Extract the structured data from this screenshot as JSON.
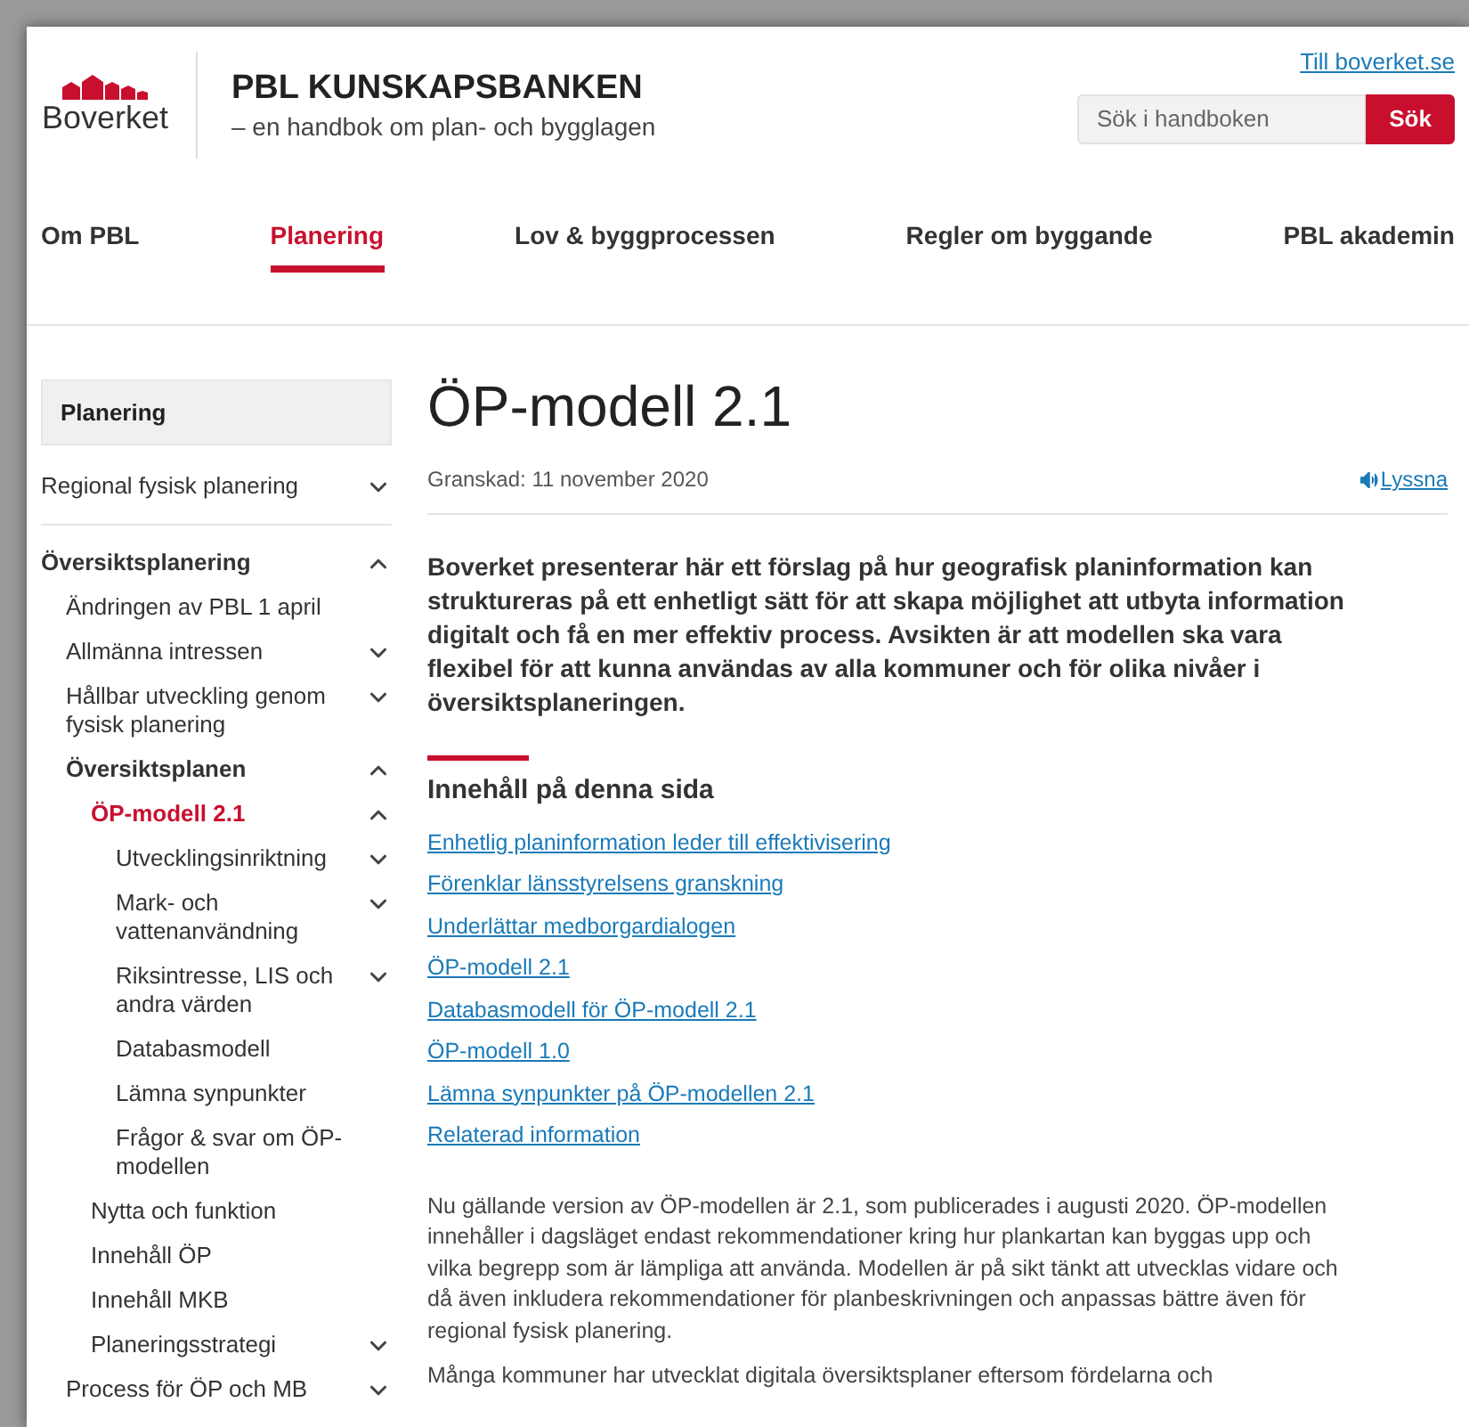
{
  "header": {
    "logo_text": "Boverket",
    "site_title": "PBL KUNSKAPSBANKEN",
    "site_subtitle": "– en handbok om plan- och bygglagen",
    "external_link": "Till boverket.se",
    "search": {
      "placeholder": "Sök i handboken",
      "button": "Sök"
    }
  },
  "nav": [
    {
      "label": "Om PBL",
      "selected": false
    },
    {
      "label": "Planering",
      "selected": true
    },
    {
      "label": "Lov & byggprocessen",
      "selected": false
    },
    {
      "label": "Regler om byggande",
      "selected": false
    },
    {
      "label": "PBL akademin",
      "selected": false
    }
  ],
  "sidebar": {
    "heading": "Planering",
    "items": [
      {
        "label": "Regional fysisk planering",
        "kind": "group",
        "expanded": false,
        "selected": false
      },
      {
        "label": "Översiktsplanering",
        "kind": "group",
        "expanded": true,
        "selected": false,
        "children": [
          {
            "label": "Ändringen av PBL 1 april",
            "kind": "leaf",
            "expanded": false,
            "selected": false
          },
          {
            "label": "Allmänna intressen",
            "kind": "group",
            "expanded": false,
            "selected": false
          },
          {
            "label": "Hållbar utveckling genom fysisk planering",
            "kind": "group",
            "expanded": false,
            "selected": false
          },
          {
            "label": "Översiktsplanen",
            "kind": "group",
            "expanded": true,
            "selected": false,
            "children": [
              {
                "label": "ÖP-modell 2.1",
                "kind": "group",
                "expanded": true,
                "selected": true,
                "children": [
                  {
                    "label": "Utvecklingsinriktning",
                    "kind": "group",
                    "expanded": false,
                    "selected": false
                  },
                  {
                    "label": "Mark- och vattenanvändning",
                    "kind": "group",
                    "expanded": false,
                    "selected": false
                  },
                  {
                    "label": "Riksintresse, LIS och andra värden",
                    "kind": "group",
                    "expanded": false,
                    "selected": false
                  },
                  {
                    "label": "Databasmodell",
                    "kind": "leaf",
                    "expanded": false,
                    "selected": false
                  },
                  {
                    "label": "Lämna synpunkter",
                    "kind": "leaf",
                    "expanded": false,
                    "selected": false
                  },
                  {
                    "label": "Frågor & svar om ÖP-modellen",
                    "kind": "leaf",
                    "expanded": false,
                    "selected": false
                  }
                ]
              },
              {
                "label": "Nytta och funktion",
                "kind": "leaf",
                "expanded": false,
                "selected": false
              },
              {
                "label": "Innehåll ÖP",
                "kind": "leaf",
                "expanded": false,
                "selected": false
              },
              {
                "label": "Innehåll MKB",
                "kind": "leaf",
                "expanded": false,
                "selected": false
              },
              {
                "label": "Planeringsstrategi",
                "kind": "group",
                "expanded": false,
                "selected": false
              }
            ]
          },
          {
            "label": "Process för ÖP och MB",
            "kind": "group",
            "expanded": false,
            "selected": false
          }
        ]
      }
    ]
  },
  "article": {
    "title": "ÖP-modell 2.1",
    "reviewed": "Granskad: 11 november 2020",
    "listen": "Lyssna",
    "lead": "Boverket presenterar här ett förslag på hur geografisk planinformation kan struktureras på ett enhetligt sätt för att skapa möjlighet att utbyta information digitalt och få en mer effektiv process. Avsikten är att modellen ska vara flexibel för att kunna användas av alla kommuner och för olika nivåer i översiktsplaneringen.",
    "toc_heading": "Innehåll på denna sida",
    "toc": [
      "Enhetlig planinformation leder till effektivisering",
      "Förenklar länsstyrelsens granskning",
      "Underlättar medborgardialogen",
      "ÖP-modell 2.1",
      "Databasmodell för ÖP-modell 2.1",
      "ÖP-modell 1.0",
      "Lämna synpunkter på ÖP-modellen 2.1",
      "Relaterad information"
    ],
    "paragraphs": [
      "Nu gällande version av ÖP-modellen är 2.1, som publicerades i augusti 2020. ÖP-modellen innehåller i dagsläget endast rekommendationer kring hur plankartan kan byggas upp och vilka begrepp som är lämpliga att använda. Modellen är på sikt tänkt att utvecklas vidare och då även inkludera rekommendationer för planbeskrivningen och anpassas bättre även för regional fysisk planering.",
      "Många kommuner har utvecklat digitala översiktsplaner eftersom fördelarna och"
    ]
  }
}
